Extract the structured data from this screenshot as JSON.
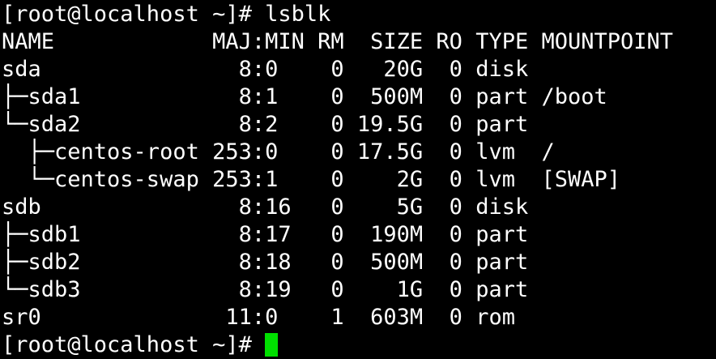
{
  "terminal": {
    "command_prompt": "[root@localhost ~]# ",
    "command": "lsblk",
    "output_lines": [
      "NAME            MAJ:MIN RM  SIZE RO TYPE MOUNTPOINT",
      "sda               8:0    0   20G  0 disk",
      "├─sda1            8:1    0  500M  0 part /boot",
      "└─sda2            8:2    0 19.5G  0 part",
      "  ├─centos-root 253:0    0 17.5G  0 lvm  /",
      "  └─centos-swap 253:1    0    2G  0 lvm  [SWAP]",
      "sdb               8:16   0    5G  0 disk",
      "├─sdb1            8:17   0  190M  0 part",
      "├─sdb2            8:18   0  500M  0 part",
      "└─sdb3            8:19   0    1G  0 part",
      "sr0              11:0    1  603M  0 rom"
    ],
    "final_prompt": "[root@localhost ~]# ",
    "colors": {
      "background": "#000000",
      "foreground": "#ffffff",
      "cursor": "#00e000"
    }
  }
}
